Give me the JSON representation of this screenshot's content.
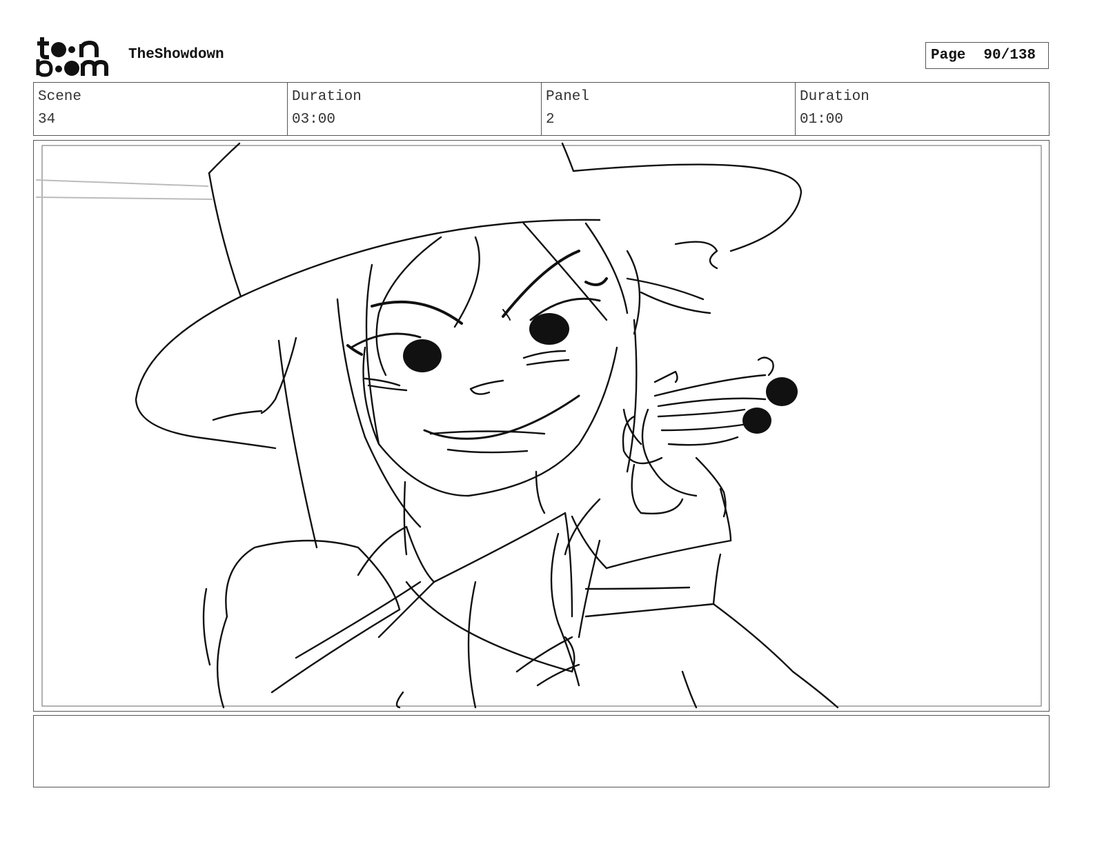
{
  "header": {
    "logo_text": "toonboom",
    "project_title": "TheShowdown",
    "page_label": "Page",
    "page_value": "90/138"
  },
  "info": {
    "scene_label": "Scene",
    "scene_value": "34",
    "scene_duration_label": "Duration",
    "scene_duration_value": "03:00",
    "panel_label": "Panel",
    "panel_value": "2",
    "panel_duration_label": "Duration",
    "panel_duration_value": "01:00"
  },
  "notes": {
    "text": ""
  }
}
